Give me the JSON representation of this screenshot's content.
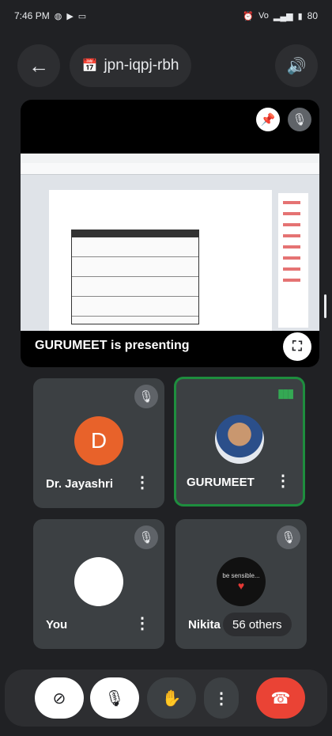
{
  "status_bar": {
    "time": "7:46 PM",
    "left_icons": [
      "whatsapp-icon",
      "youtube-icon",
      "cast-icon"
    ],
    "right_icons": [
      "alarm-icon",
      "volte-icon",
      "signal-icon",
      "battery-icon"
    ],
    "battery": "80"
  },
  "topbar": {
    "back_glyph": "←",
    "calendar_glyph": "📅",
    "meeting_code": "jpn-iqpj-rbh",
    "speaker_glyph": "🔊"
  },
  "presentation": {
    "label": "GURUMEET is presenting",
    "pin_glyph": "📌",
    "mic_off_glyph": "🎙",
    "fullscreen_glyph": "⛶"
  },
  "tiles": [
    {
      "name": "Dr. Jayashri",
      "avatar_letter": "D",
      "muted": true
    },
    {
      "name": "GURUMEET",
      "speaking": true
    },
    {
      "name": "You",
      "muted": true
    },
    {
      "name": "Nikita",
      "muted": true,
      "others": "56 others",
      "avatar_text": "be sensible..."
    }
  ],
  "controls": {
    "camera_glyph": "⊘",
    "mic_glyph": "🎙",
    "hand_glyph": "✋",
    "more_glyph": "⋮",
    "end_glyph": "☎"
  },
  "colors": {
    "background": "#202124",
    "end_call": "#ea4335",
    "speaking_border": "#1e8e3e",
    "avatar_orange": "#e8622a"
  }
}
